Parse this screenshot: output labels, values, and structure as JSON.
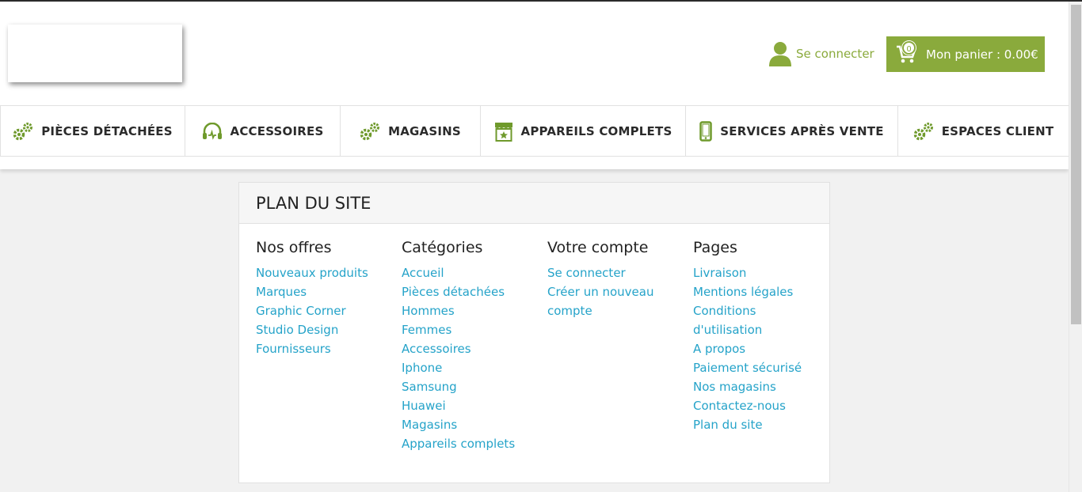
{
  "header": {
    "login_label": "Se connecter",
    "cart_label": "Mon panier : 0.00€",
    "cart_count": "0"
  },
  "nav": {
    "items": [
      {
        "label": "PIÈCES DÉTACHÉES",
        "icon": "gears-icon"
      },
      {
        "label": "ACCESSOIRES",
        "icon": "headphones-icon"
      },
      {
        "label": "MAGASINS",
        "icon": "gears-icon"
      },
      {
        "label": "APPAREILS COMPLETS",
        "icon": "store-icon"
      },
      {
        "label": "SERVICES APRÈS VENTE",
        "icon": "smartphone-icon"
      },
      {
        "label": "ESPACES CLIENT",
        "icon": "gears-icon"
      }
    ]
  },
  "sitemap": {
    "title": "PLAN DU SITE",
    "columns": [
      {
        "heading": "Nos offres",
        "links": [
          "Nouveaux produits",
          "Marques",
          "Graphic Corner",
          "Studio Design",
          "Fournisseurs"
        ]
      },
      {
        "heading": "Catégories",
        "links": [
          "Accueil",
          "Pièces détachées",
          "Hommes",
          "Femmes",
          "Accessoires",
          "Iphone",
          "Samsung",
          "Huawei",
          "Magasins",
          "Appareils complets"
        ]
      },
      {
        "heading": "Votre compte",
        "links": [
          "Se connecter",
          "Créer un nouveau",
          "compte"
        ]
      },
      {
        "heading": "Pages",
        "links": [
          "Livraison",
          "Mentions légales",
          "Conditions",
          "d'utilisation",
          "A propos",
          "Paiement sécurisé",
          "Nos magasins",
          "Contactez-nous",
          "Plan du site"
        ]
      }
    ]
  },
  "colors": {
    "accent": "#8aaa3c",
    "link": "#25a3c9"
  }
}
